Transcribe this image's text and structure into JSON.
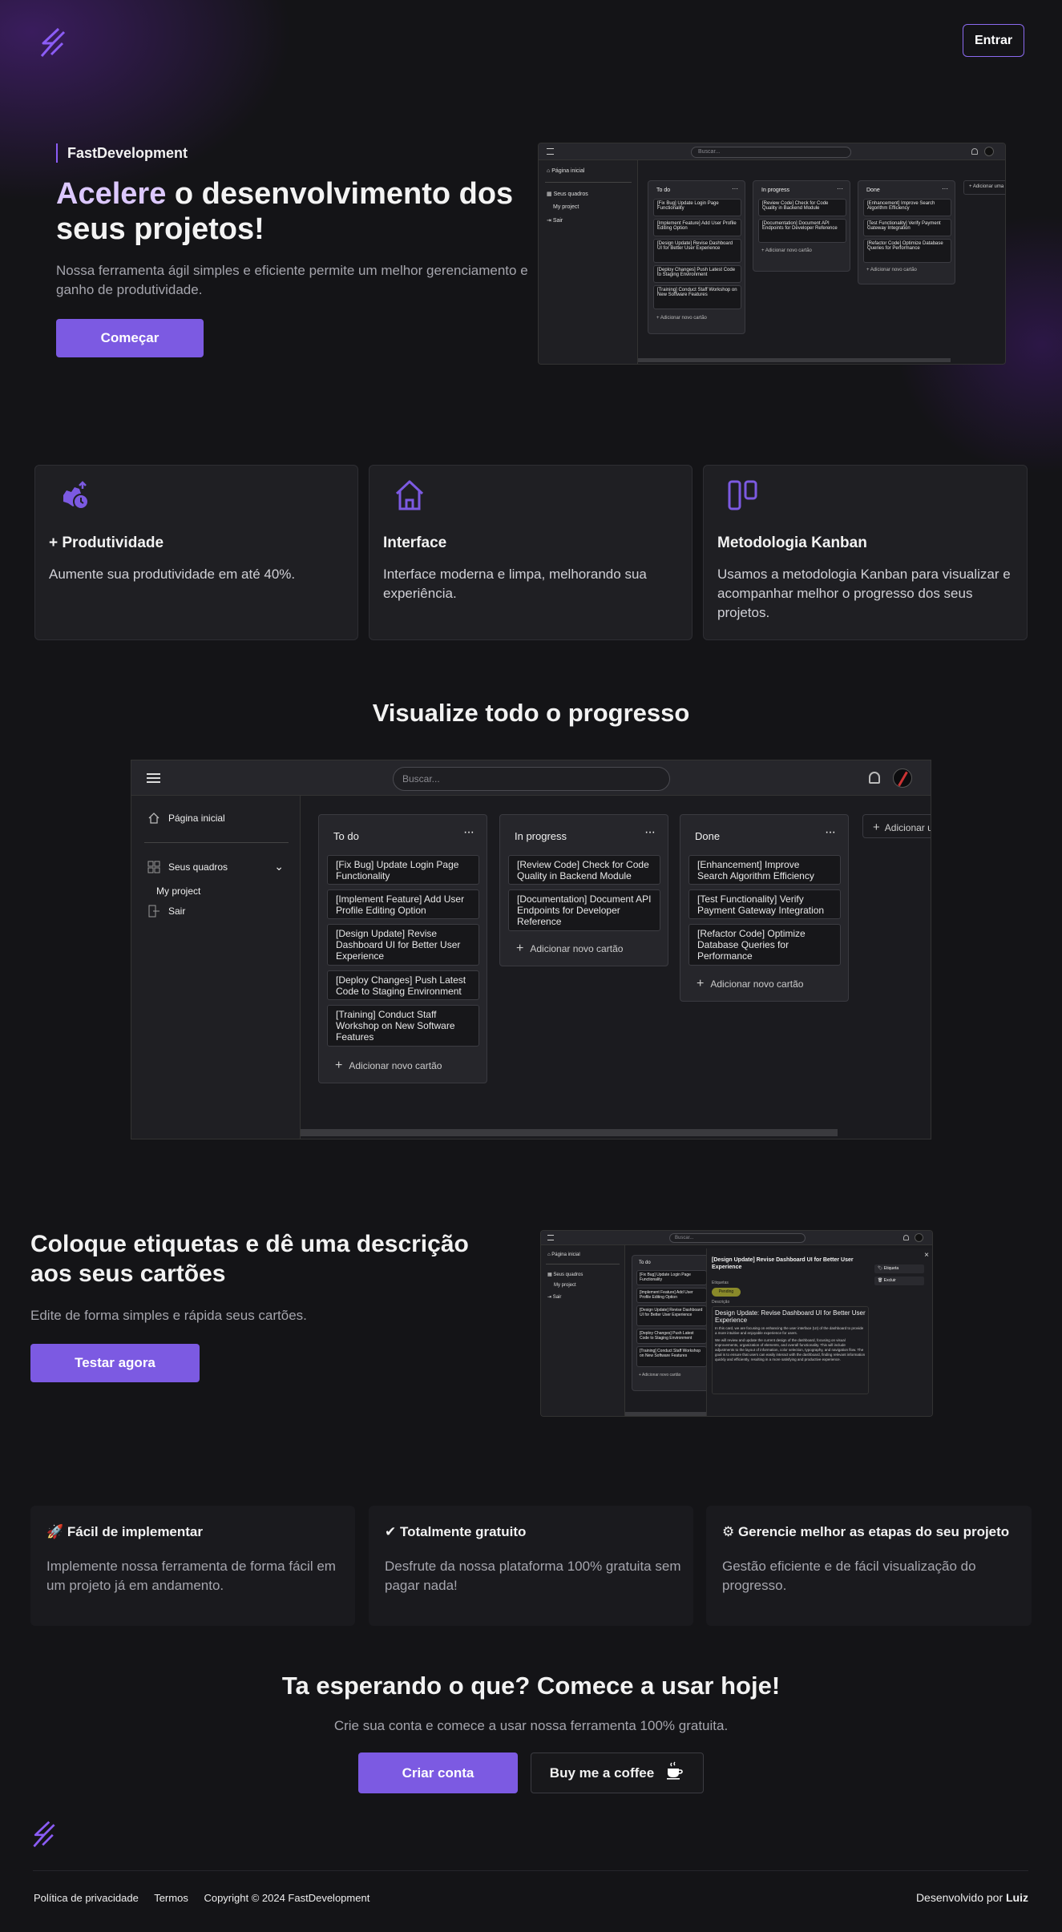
{
  "header": {
    "logo_icon": "bolt-logo-icon",
    "login_label": "Entrar"
  },
  "hero": {
    "brand": "FastDevelopment",
    "title_highlight": "Acelere",
    "title_rest_line1": " o desenvolvimento dos",
    "title_line2": "seus projetos!",
    "subtitle": "Nossa ferramenta ágil simples e eficiente permite um melhor gerenciamento e ganho de produtividade.",
    "cta_label": "Começar"
  },
  "board": {
    "search_placeholder": "Buscar...",
    "sidebar": {
      "home": "Página inicial",
      "boards": "Seus quadros",
      "project": "My project",
      "logout": "Sair"
    },
    "add_list": "Adicionar uma lista",
    "add_card": "Adicionar novo cartão",
    "columns": [
      {
        "title": "To do",
        "cards": [
          "[Fix Bug] Update Login Page Functionality",
          "[Implement Feature] Add User Profile Editing Option",
          "[Design Update] Revise Dashboard UI for Better User Experience",
          "[Deploy Changes] Push Latest Code to Staging Environment",
          "[Training] Conduct Staff Workshop on New Software Features"
        ]
      },
      {
        "title": "In progress",
        "cards": [
          "[Review Code] Check for Code Quality in Backend Module",
          "[Documentation] Document API Endpoints for Developer Reference"
        ]
      },
      {
        "title": "Done",
        "cards": [
          "[Enhancement] Improve Search Algorithm Efficiency",
          "[Test Functionality] Verify Payment Gateway Integration",
          "[Refactor Code] Optimize Database Queries for Performance"
        ]
      }
    ]
  },
  "features": [
    {
      "icon": "productivity-clock-icon",
      "title": "+ Produtividade",
      "text": "Aumente sua produtividade em até 40%."
    },
    {
      "icon": "home-icon",
      "title": "Interface",
      "text": "Interface moderna e limpa, melhorando sua experiência."
    },
    {
      "icon": "kanban-icon",
      "title": "Metodologia Kanban",
      "text": "Usamos a metodologia Kanban para visualizar e acompanhar melhor o progresso dos seus projetos."
    }
  ],
  "progress_section": {
    "title": "Visualize todo o progresso"
  },
  "labels_section": {
    "title": "Coloque etiquetas e dê uma descrição aos seus cartões",
    "subtitle": "Edite de forma simples e rápida seus cartões.",
    "cta_label": "Testar agora",
    "modal": {
      "card_title": "[Design Update] Revise Dashboard UI for Better User Experience",
      "labels_heading": "Etiquetas",
      "label_tag": "Pending",
      "desc_heading": "Descrição",
      "desc_title": "Design Update: Revise Dashboard UI for Better User Experience",
      "desc_p1": "In this card, we are focusing on enhancing the user interface (UI) of the dashboard to provide a more intuitive and enjoyable experience for users.",
      "desc_p2": "We will review and update the current design of the dashboard, focusing on visual improvements, organization of elements, and overall functionality. This will include adjustments to the layout of information, color selection, typography, and navigation flow. The goal is to ensure that users can easily interact with the dashboard, finding relevant information quickly and efficiently, resulting in a more satisfying and productive experience.",
      "side_labels": "Etiqueta",
      "side_delete": "Excluir"
    }
  },
  "benefits": [
    {
      "icon": "rocket-icon",
      "title": "🚀 Fácil de implementar",
      "text": "Implemente nossa ferramenta de forma fácil em um projeto já em andamento."
    },
    {
      "icon": "check-icon",
      "title": "✔ Totalmente gratuito",
      "text": "Desfrute da nossa plataforma 100% gratuita sem pagar nada!"
    },
    {
      "icon": "gear-icon",
      "title": "⚙ Gerencie melhor as etapas do seu projeto",
      "text": "Gestão eficiente e de fácil visualização do progresso."
    }
  ],
  "cta": {
    "title": "Ta esperando o que? Comece a usar hoje!",
    "subtitle": "Crie sua conta e comece a usar nossa ferramenta 100% gratuita.",
    "create_label": "Criar conta",
    "coffee_label": "Buy me a coffee",
    "coffee_icon": "coffee-icon"
  },
  "footer": {
    "privacy": "Política de privacidade",
    "terms": "Termos",
    "copyright": "Copyright © 2024 FastDevelopment",
    "dev_prefix": "Desenvolvido por ",
    "dev_name": "Luiz"
  },
  "colors": {
    "accent": "#7c5ae2",
    "background": "#141417",
    "card": "#1f1f23"
  }
}
